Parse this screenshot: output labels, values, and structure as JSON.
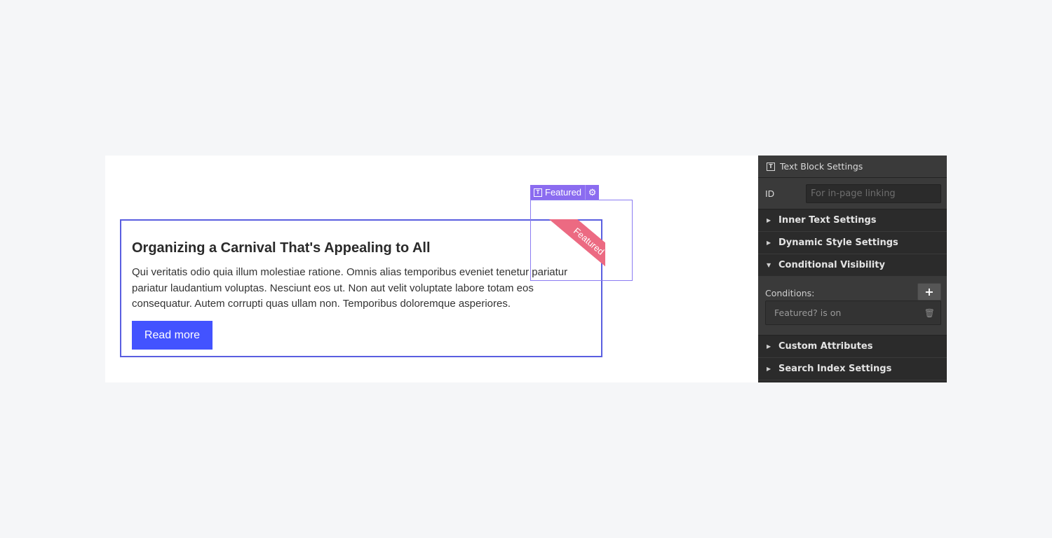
{
  "canvas": {
    "card": {
      "title": "Organizing a Carnival That's Appealing to All",
      "body": "Qui veritatis odio quia illum molestiae ratione. Omnis alias temporibus eveniet tenetur pariatur pariatur laudantium voluptas. Nesciunt eos ut. Non aut velit voluptate labore totam eos consequatur. Autem corrupti quas ullam non. Temporibus doloremque asperiores.",
      "button_label": "Read more"
    },
    "ribbon": {
      "label": "Featured",
      "color": "#ec6a82"
    },
    "selection_tag": {
      "label": "Featured",
      "icon": "text-block-icon",
      "settings_icon": "gear-icon",
      "color": "#8b6cf0"
    },
    "accent_color": "#4353ff"
  },
  "panel": {
    "title": "Text Block Settings",
    "title_icon": "text-block-icon",
    "id_field": {
      "label": "ID",
      "value": "",
      "placeholder": "For in-page linking"
    },
    "sections": [
      {
        "label": "Inner Text Settings",
        "expanded": false
      },
      {
        "label": "Dynamic Style Settings",
        "expanded": false
      },
      {
        "label": "Conditional Visibility",
        "expanded": true
      },
      {
        "label": "Custom Attributes",
        "expanded": false
      },
      {
        "label": "Search Index Settings",
        "expanded": false
      }
    ],
    "conditional_visibility": {
      "conditions_label": "Conditions:",
      "add_icon": "+",
      "conditions": [
        {
          "text": "Featured? is on"
        }
      ]
    }
  }
}
